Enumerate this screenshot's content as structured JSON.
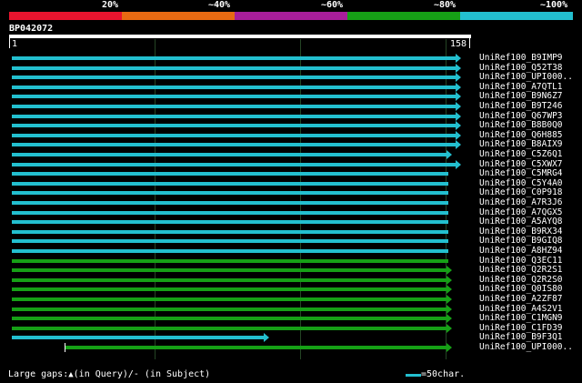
{
  "legend": {
    "colors": [
      "#e8142e",
      "#e86a12",
      "#a81e9a",
      "#16a016",
      "#23bfcf"
    ],
    "labels": [
      "20%",
      "~40%",
      "~60%",
      "~80%",
      "~100%"
    ]
  },
  "query": {
    "name": "BP042072",
    "start": "1",
    "end": "158"
  },
  "hits": [
    {
      "name": "UniRef100_B9IMP9",
      "color": "cyan",
      "start_frac": 0.0,
      "end_frac": 1.0,
      "arrow": true
    },
    {
      "name": "UniRef100_Q52T38",
      "color": "cyan",
      "start_frac": 0.0,
      "end_frac": 1.0,
      "arrow": true
    },
    {
      "name": "UniRef100_UPI000..",
      "color": "cyan",
      "start_frac": 0.0,
      "end_frac": 1.0,
      "arrow": true
    },
    {
      "name": "UniRef100_A7QTL1",
      "color": "cyan",
      "start_frac": 0.0,
      "end_frac": 1.0,
      "arrow": true
    },
    {
      "name": "UniRef100_B9N6Z7",
      "color": "cyan",
      "start_frac": 0.0,
      "end_frac": 1.0,
      "arrow": true
    },
    {
      "name": "UniRef100_B9T246",
      "color": "cyan",
      "start_frac": 0.0,
      "end_frac": 1.0,
      "arrow": true
    },
    {
      "name": "UniRef100_Q67WP3",
      "color": "cyan",
      "start_frac": 0.0,
      "end_frac": 1.0,
      "arrow": true
    },
    {
      "name": "UniRef100_B8B0Q0",
      "color": "cyan",
      "start_frac": 0.0,
      "end_frac": 1.0,
      "arrow": true
    },
    {
      "name": "UniRef100_Q6H885",
      "color": "cyan",
      "start_frac": 0.0,
      "end_frac": 1.0,
      "arrow": true
    },
    {
      "name": "UniRef100_B8AIX9",
      "color": "cyan",
      "start_frac": 0.0,
      "end_frac": 1.0,
      "arrow": true
    },
    {
      "name": "UniRef100_C5Z6Q1",
      "color": "cyan",
      "start_frac": 0.0,
      "end_frac": 0.98,
      "arrow": true
    },
    {
      "name": "UniRef100_C5XWX7",
      "color": "cyan",
      "start_frac": 0.0,
      "end_frac": 1.0,
      "arrow": true
    },
    {
      "name": "UniRef100_C5MRG4",
      "color": "cyan",
      "start_frac": 0.0,
      "end_frac": 0.98,
      "arrow": false
    },
    {
      "name": "UniRef100_C5Y4A0",
      "color": "cyan",
      "start_frac": 0.0,
      "end_frac": 0.98,
      "arrow": false
    },
    {
      "name": "UniRef100_C0P918",
      "color": "cyan",
      "start_frac": 0.0,
      "end_frac": 0.98,
      "arrow": false
    },
    {
      "name": "UniRef100_A7R3J6",
      "color": "cyan",
      "start_frac": 0.0,
      "end_frac": 0.98,
      "arrow": false
    },
    {
      "name": "UniRef100_A7QGX5",
      "color": "cyan",
      "start_frac": 0.0,
      "end_frac": 0.98,
      "arrow": false
    },
    {
      "name": "UniRef100_A5AYQ8",
      "color": "cyan",
      "start_frac": 0.0,
      "end_frac": 0.98,
      "arrow": false
    },
    {
      "name": "UniRef100_B9RX34",
      "color": "cyan",
      "start_frac": 0.0,
      "end_frac": 0.98,
      "arrow": false
    },
    {
      "name": "UniRef100_B9GIQ8",
      "color": "cyan",
      "start_frac": 0.0,
      "end_frac": 0.98,
      "arrow": false
    },
    {
      "name": "UniRef100_A8HZ94",
      "color": "cyan",
      "start_frac": 0.0,
      "end_frac": 0.98,
      "arrow": false
    },
    {
      "name": "UniRef100_Q3EC11",
      "color": "green",
      "start_frac": 0.0,
      "end_frac": 0.98,
      "arrow": false
    },
    {
      "name": "UniRef100_Q2R2S1",
      "color": "green",
      "start_frac": 0.0,
      "end_frac": 0.98,
      "arrow": true
    },
    {
      "name": "UniRef100_Q2R2S0",
      "color": "green",
      "start_frac": 0.0,
      "end_frac": 0.98,
      "arrow": true
    },
    {
      "name": "UniRef100_Q0IS80",
      "color": "green",
      "start_frac": 0.0,
      "end_frac": 0.98,
      "arrow": true
    },
    {
      "name": "UniRef100_A2ZF87",
      "color": "green",
      "start_frac": 0.0,
      "end_frac": 0.98,
      "arrow": true
    },
    {
      "name": "UniRef100_A4S2V1",
      "color": "green",
      "start_frac": 0.0,
      "end_frac": 0.98,
      "arrow": true
    },
    {
      "name": "UniRef100_C1MGN9",
      "color": "green",
      "start_frac": 0.0,
      "end_frac": 0.98,
      "arrow": true
    },
    {
      "name": "UniRef100_C1FD39",
      "color": "green",
      "start_frac": 0.0,
      "end_frac": 0.98,
      "arrow": true
    },
    {
      "name": "UniRef100_B9F3Q1",
      "color": "cyan",
      "start_frac": 0.0,
      "end_frac": 0.57,
      "arrow": true
    },
    {
      "name": "UniRef100_UPI000..",
      "color": "green",
      "start_frac": 0.118,
      "end_frac": 0.98,
      "arrow": true
    }
  ],
  "colors": {
    "cyan": "#23bfcf",
    "green": "#16a016"
  },
  "footer": {
    "prefix": "Large gaps:",
    "gap_icon": "triangle-up-icon",
    "gap_icon_glyph": "▲",
    "text": "(in Query)/- (in Subject)",
    "scale_label": "=50char."
  }
}
